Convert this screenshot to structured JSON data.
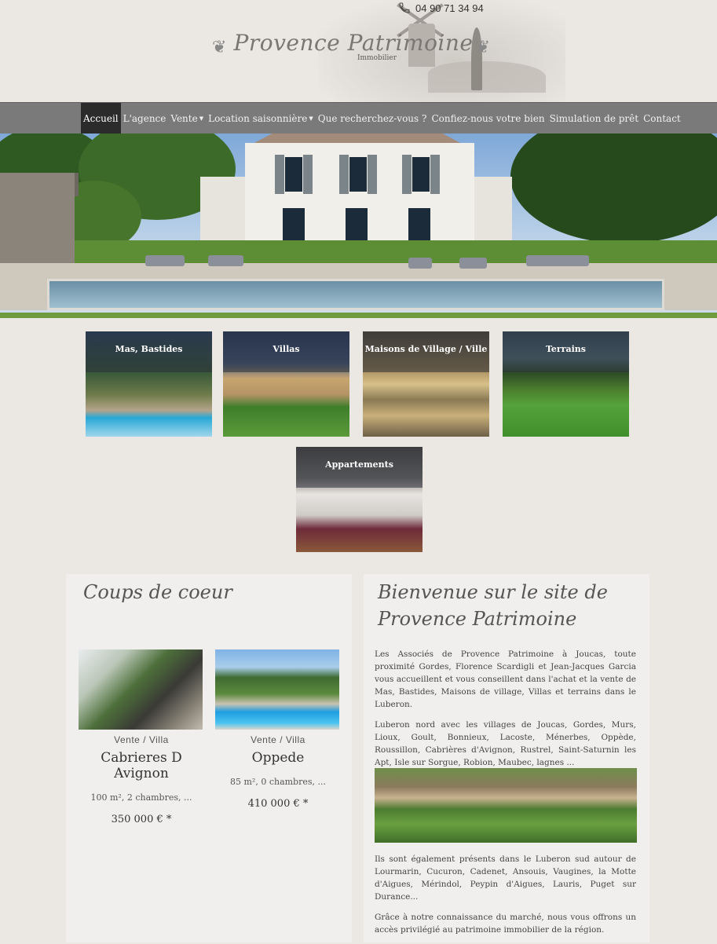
{
  "header": {
    "phone": "04 90 71 34 94",
    "logo_title": "Provence Patrimoine",
    "logo_subtitle": "Immobilier"
  },
  "nav": {
    "items": [
      {
        "label": "Accueil",
        "active": true,
        "dropdown": false
      },
      {
        "label": "L'agence",
        "active": false,
        "dropdown": false
      },
      {
        "label": "Vente",
        "active": false,
        "dropdown": true
      },
      {
        "label": "Location saisonnière",
        "active": false,
        "dropdown": true
      },
      {
        "label": "Que recherchez-vous ?",
        "active": false,
        "dropdown": false
      },
      {
        "label": "Confiez-nous votre bien",
        "active": false,
        "dropdown": false
      },
      {
        "label": "Simulation de prêt",
        "active": false,
        "dropdown": false
      },
      {
        "label": "Contact",
        "active": false,
        "dropdown": false
      }
    ]
  },
  "categories": [
    {
      "label": "Mas, Bastides"
    },
    {
      "label": "Villas"
    },
    {
      "label": "Maisons de Village / Ville"
    },
    {
      "label": "Terrains"
    },
    {
      "label": "Appartements"
    }
  ],
  "favorites": {
    "title": "Coups de coeur",
    "listings": [
      {
        "type": "Vente / Villa",
        "name": "Cabrieres D Avignon",
        "details": "100 m², 2 chambres, ...",
        "price": "350 000 € *"
      },
      {
        "type": "Vente / Villa",
        "name": "Oppede",
        "details": "85 m², 0 chambres, ...",
        "price": "410 000 € *"
      }
    ]
  },
  "welcome": {
    "title_line1": "Bienvenue sur le site de",
    "title_line2": "Provence Patrimoine",
    "paragraphs": [
      "Les Associés de Provence Patrimoine à Joucas, toute proximité Gordes, Florence Scardigli et Jean-Jacques Garcia vous accueillent et vous conseillent dans l'achat et la vente de Mas, Bastides, Maisons de village, Villas et terrains dans le Luberon.",
      "Luberon nord avec les villages de Joucas, Gordes, Murs, Lioux, Goult, Bonnieux, Lacoste, Ménerbes, Oppède, Roussillon, Cabrières d'Avignon, Rustrel, Saint-Saturnin les Apt, Isle sur Sorgue, Robion, Maubec, lagnes ...",
      "Ils sont également présents dans le Luberon sud autour de Lourmarin, Cucuron, Cadenet, Ansouis, Vaugines, la Motte d'Aigues, Mérindol, Peypin d'Aigues, Lauris, Puget sur Durance...",
      "Grâce à notre connaissance du marché, nous vous offrons un accès privilégié au patrimoine immobilier de la région."
    ]
  }
}
